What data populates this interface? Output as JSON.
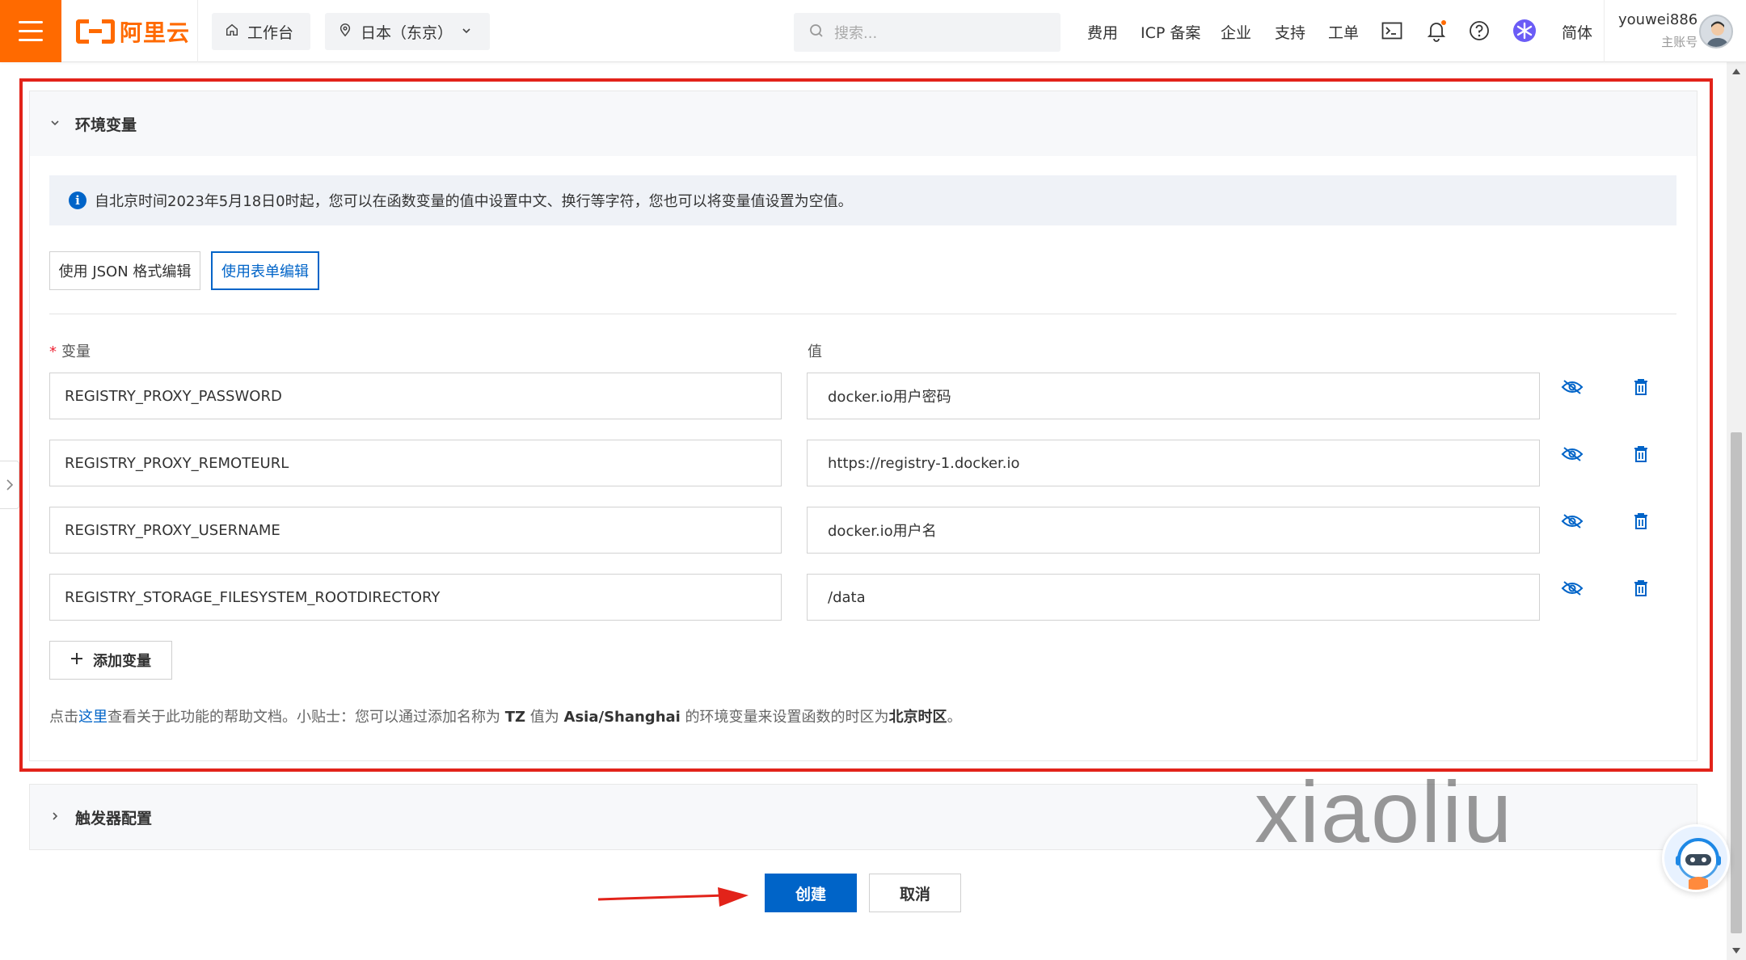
{
  "header": {
    "logo_text": "阿里云",
    "workbench": "工作台",
    "region": "日本（东京）",
    "search_placeholder": "搜索...",
    "links": [
      "费用",
      "ICP 备案",
      "企业",
      "支持",
      "工单"
    ],
    "lang": "简体",
    "username": "youwei886",
    "account_type": "主账号"
  },
  "env_section": {
    "title": "环境变量",
    "notice": "自北京时间2023年5月18日0时起，您可以在函数变量的值中设置中文、换行等字符，您也可以将变量值设置为空值。",
    "mode_json": "使用 JSON 格式编辑",
    "mode_form": "使用表单编辑",
    "required_mark": "*",
    "col_key": "变量",
    "col_value": "值",
    "rows": [
      {
        "key": "REGISTRY_PROXY_PASSWORD",
        "value": "docker.io用户密码"
      },
      {
        "key": "REGISTRY_PROXY_REMOTEURL",
        "value": "https://registry-1.docker.io"
      },
      {
        "key": "REGISTRY_PROXY_USERNAME",
        "value": "docker.io用户名"
      },
      {
        "key": "REGISTRY_STORAGE_FILESYSTEM_ROOTDIRECTORY",
        "value": "/data"
      }
    ],
    "add_label": "添加变量",
    "help": {
      "prefix": "点击",
      "link": "这里",
      "mid1": "查看关于此功能的帮助文档。小贴士：您可以通过添加名称为 ",
      "tz": "TZ",
      "mid2": " 值为 ",
      "zone": "Asia/Shanghai",
      "mid3": " 的环境变量来设置函数的时区为",
      "bj": "北京时区",
      "end": "。"
    }
  },
  "trigger_section": {
    "title": "触发器配置"
  },
  "actions": {
    "create": "创建",
    "cancel": "取消"
  },
  "watermark": "xiaoliu",
  "colors": {
    "brand": "#ff6a00",
    "primary": "#0064c8",
    "highlight": "#e2231a"
  },
  "icons": [
    "menu-icon",
    "home-icon",
    "location-icon",
    "chevron-down-icon",
    "search-icon",
    "terminal-icon",
    "bell-icon",
    "help-icon",
    "ai-assistant-icon",
    "eye-off-icon",
    "trash-icon",
    "plus-icon",
    "chevron-right-icon"
  ]
}
